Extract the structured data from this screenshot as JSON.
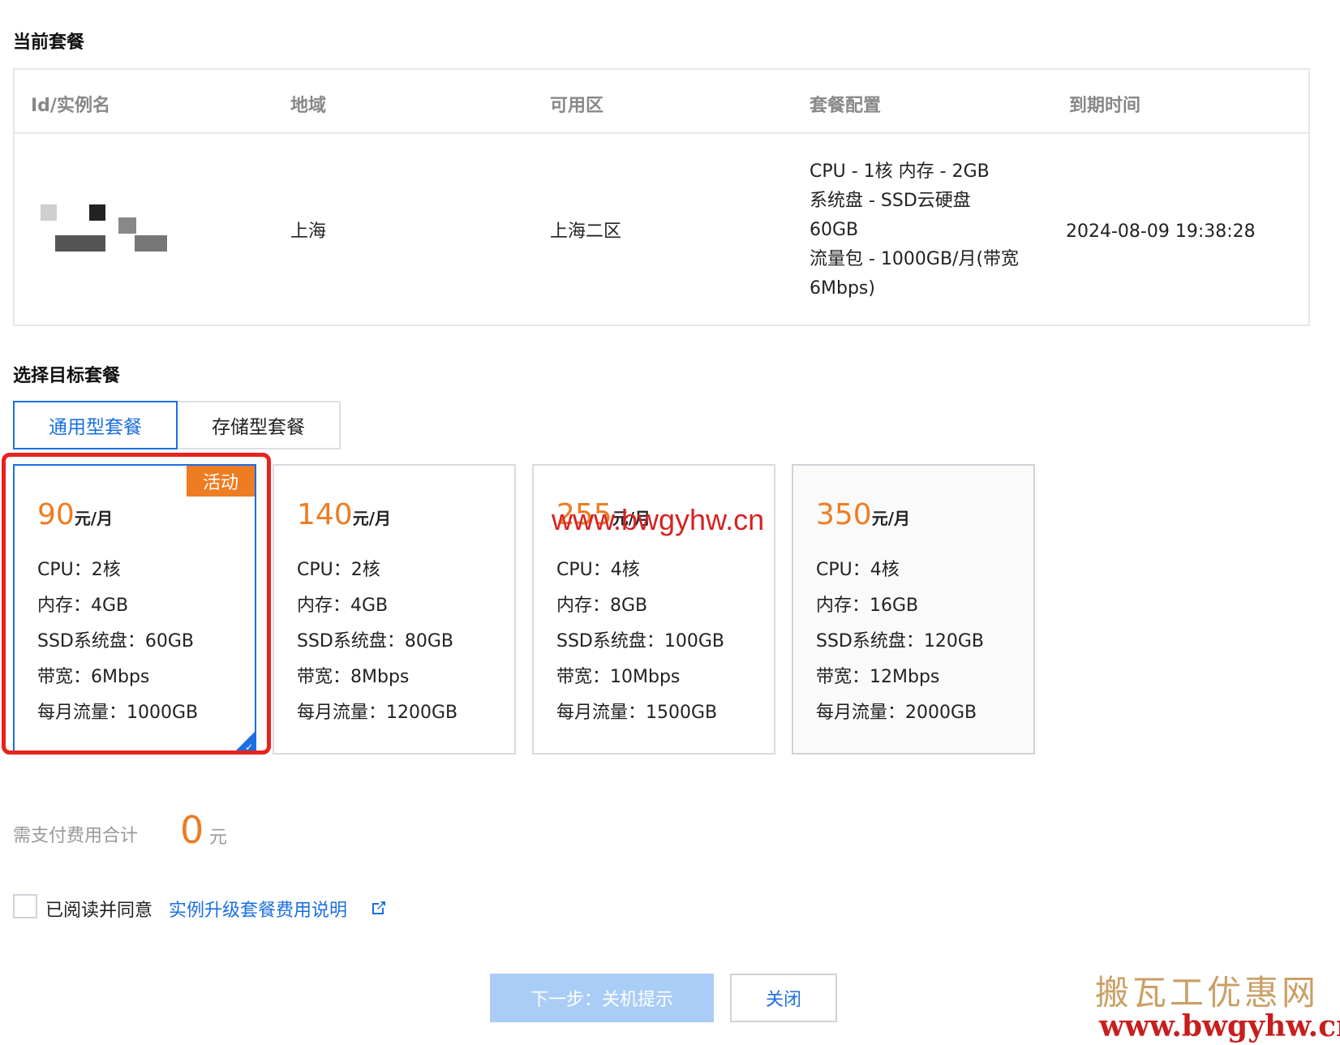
{
  "current_plan": {
    "title": "当前套餐",
    "headers": [
      "Id/实例名",
      "地域",
      "可用区",
      "套餐配置",
      "到期时间"
    ],
    "row": {
      "region": "上海",
      "zone": "上海二区",
      "config_lines": [
        "CPU - 1核 内存 - 2GB",
        "系统盘 - SSD云硬盘",
        "60GB",
        "流量包 - 1000GB/月(带宽",
        "6Mbps)"
      ],
      "expire": "2024-08-09 19:38:28"
    }
  },
  "target": {
    "title": "选择目标套餐",
    "tabs": [
      {
        "label": "通用型套餐",
        "active": true
      },
      {
        "label": "存储型套餐",
        "active": false
      }
    ],
    "cards": [
      {
        "price": "90",
        "unit": "元/月",
        "badge": "活动",
        "cpu": "CPU：2核",
        "mem": "内存：4GB",
        "disk": "SSD系统盘：60GB",
        "bw": "带宽：6Mbps",
        "traffic": "每月流量：1000GB",
        "selected": true
      },
      {
        "price": "140",
        "unit": "元/月",
        "cpu": "CPU：2核",
        "mem": "内存：4GB",
        "disk": "SSD系统盘：80GB",
        "bw": "带宽：8Mbps",
        "traffic": "每月流量：1200GB"
      },
      {
        "price": "255",
        "unit": "元/月",
        "cpu": "CPU：4核",
        "mem": "内存：8GB",
        "disk": "SSD系统盘：100GB",
        "bw": "带宽：10Mbps",
        "traffic": "每月流量：1500GB"
      },
      {
        "price": "350",
        "unit": "元/月",
        "cpu": "CPU：4核",
        "mem": "内存：16GB",
        "disk": "SSD系统盘：120GB",
        "bw": "带宽：12Mbps",
        "traffic": "每月流量：2000GB"
      }
    ]
  },
  "total": {
    "label": "需支付费用合计",
    "amount": "0",
    "unit": "元"
  },
  "agreement": {
    "text": "已阅读并同意",
    "link": "实例升级套餐费用说明"
  },
  "buttons": {
    "next": "下一步：关机提示",
    "close": "关闭"
  },
  "watermarks": {
    "mid": "www.bwgyhw.cn",
    "br_title": "搬瓦工优惠网",
    "br_url": "www.bwgyhw.cn"
  },
  "colors": {
    "accent": "#1b6fe0",
    "price": "#ee7c22",
    "highlight": "#e8221c"
  }
}
